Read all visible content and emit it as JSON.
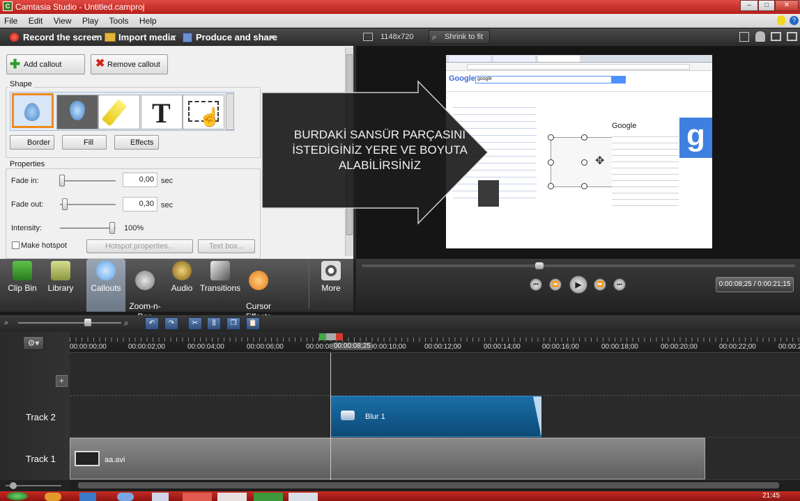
{
  "window": {
    "title": "Camtasia Studio - Untitled.camproj",
    "app_icon_label": "C"
  },
  "menu": [
    "File",
    "Edit",
    "View",
    "Play",
    "Tools",
    "Help"
  ],
  "toolbar": {
    "record": "Record the screen",
    "import": "Import media",
    "produce": "Produce and share"
  },
  "callouts": {
    "add": "Add callout",
    "remove": "Remove callout",
    "shape_label": "Shape",
    "text_shape": "T",
    "border": "Border",
    "fill": "Fill",
    "effects": "Effects",
    "properties_label": "Properties",
    "fade_in_label": "Fade in:",
    "fade_in_value": "0,00",
    "fade_out_label": "Fade out:",
    "fade_out_value": "0,30",
    "unit": "sec",
    "intensity_label": "Intensity:",
    "intensity_value": "100%",
    "make_hotspot": "Make hotspot",
    "hotspot_properties": "Hotspot properties...",
    "text_box": "Text box..."
  },
  "tabs": [
    {
      "label": "Clip Bin",
      "icon": "film-icon",
      "color": "#3f9d2f"
    },
    {
      "label": "Library",
      "icon": "library-icon",
      "color": "#a9b36a"
    },
    {
      "label": "Callouts",
      "icon": "callout-icon",
      "color": "#5aa3e6"
    },
    {
      "label": "Zoom-n-\nPan",
      "icon": "magnifier-icon",
      "color": "#999999"
    },
    {
      "label": "Audio",
      "icon": "speaker-icon",
      "color": "#c9a13a"
    },
    {
      "label": "Transitions",
      "icon": "transitions-icon",
      "color": "#8a8a8a"
    },
    {
      "label": "Cursor\nEffects",
      "icon": "cursor-effects-icon",
      "color": "#f08a1c"
    },
    {
      "label": "More",
      "icon": "more-icon",
      "color": "#cccccc"
    }
  ],
  "preview": {
    "dimensions": "1148x720",
    "zoom": "Shrink to fit",
    "overlay_text_line1": "BURDAKİ SANSÜR PARÇASINI",
    "overlay_text_line2": "İSTEDİGİNİZ YERE VE BOYUTA",
    "overlay_text_line3": "ALABİLİRSİNİZ",
    "google_logo": "Google",
    "google_query": "google",
    "google_panel_title": "Google",
    "google_panel_letter": "g"
  },
  "player": {
    "time": "0:00:08;25 / 0:00:21;15"
  },
  "timeline": {
    "ticks": [
      "00:00:00;00",
      "00:00:02;00",
      "00:00:04;00",
      "00:00:06;00",
      "00:00:08;",
      "00:00:10;00",
      "00:00:12;00",
      "00:00:14;00",
      "00:00:16;00",
      "00:00:18;00",
      "00:00:20;00",
      "00:00:22;00",
      "00:00:2"
    ],
    "playhead": "00:00:08;25",
    "tracks": [
      {
        "label": "Track 2",
        "clip": "Blur 1"
      },
      {
        "label": "Track 1",
        "clip": "aa.avi"
      }
    ],
    "add_track": "+"
  },
  "taskbar": {
    "clock": "21:45"
  }
}
